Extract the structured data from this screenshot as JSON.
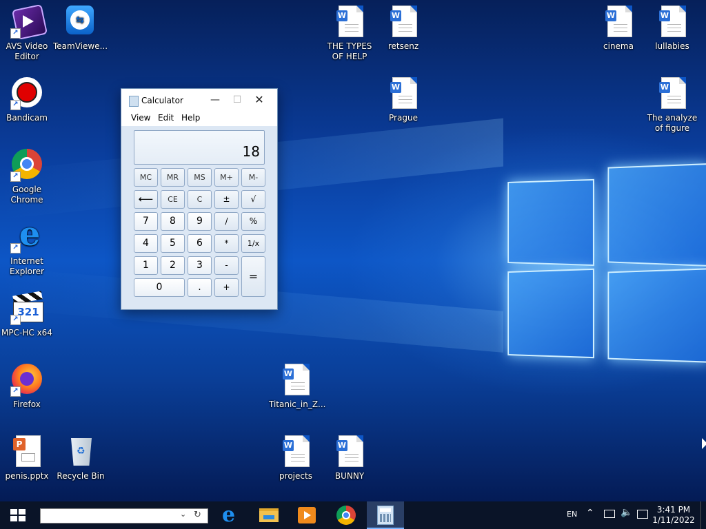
{
  "desktop_icons": [
    {
      "label": "AVS Video Editor",
      "icon": "avs-video-editor-icon"
    },
    {
      "label": "TeamViewe...",
      "icon": "teamviewer-icon"
    },
    {
      "label": "Bandicam",
      "icon": "bandicam-icon"
    },
    {
      "label": "Google Chrome",
      "icon": "chrome-icon"
    },
    {
      "label": "Internet Explorer",
      "icon": "internet-explorer-icon"
    },
    {
      "label": "MPC-HC x64",
      "icon": "mpc-hc-icon"
    },
    {
      "label": "Firefox",
      "icon": "firefox-icon"
    },
    {
      "label": "penis.pptx",
      "icon": "powerpoint-file-icon"
    },
    {
      "label": "Recycle Bin",
      "icon": "recycle-bin-icon"
    },
    {
      "label": "THE TYPES OF HELP",
      "icon": "word-document-icon"
    },
    {
      "label": "retsenz",
      "icon": "word-document-icon"
    },
    {
      "label": "Prague",
      "icon": "word-document-icon"
    },
    {
      "label": "cinema",
      "icon": "word-document-icon"
    },
    {
      "label": "lullabies",
      "icon": "word-document-icon"
    },
    {
      "label": "The analyze of figure",
      "icon": "word-document-icon"
    },
    {
      "label": "Titanic_in_Z...",
      "icon": "word-document-icon"
    },
    {
      "label": "projects",
      "icon": "word-document-icon"
    },
    {
      "label": "BUNNY",
      "icon": "word-document-icon"
    }
  ],
  "calculator": {
    "title": "Calculator",
    "menu": [
      "View",
      "Edit",
      "Help"
    ],
    "display": "18",
    "keys": {
      "mc": "MC",
      "mr": "MR",
      "ms": "MS",
      "mplus": "M+",
      "mminus": "M-",
      "back": "⟵",
      "ce": "CE",
      "c": "C",
      "pm": "±",
      "sqrt": "√",
      "k7": "7",
      "k8": "8",
      "k9": "9",
      "div": "/",
      "pct": "%",
      "k4": "4",
      "k5": "5",
      "k6": "6",
      "mul": "*",
      "inv": "1/x",
      "k1": "1",
      "k2": "2",
      "k3": "3",
      "sub": "-",
      "eq": "=",
      "k0": "0",
      "dot": ".",
      "add": "+"
    }
  },
  "taskbar": {
    "search_value": "",
    "pinned": [
      "edge-icon",
      "file-explorer-icon",
      "media-player-icon",
      "chrome-icon",
      "calculator-icon"
    ],
    "language": "EN",
    "time": "3:41 PM",
    "date": "1/11/2022"
  },
  "colors": {
    "taskbar": "#0a1428",
    "desktop_blue": "#0d56c6",
    "calc_body": "#dce7f4"
  }
}
